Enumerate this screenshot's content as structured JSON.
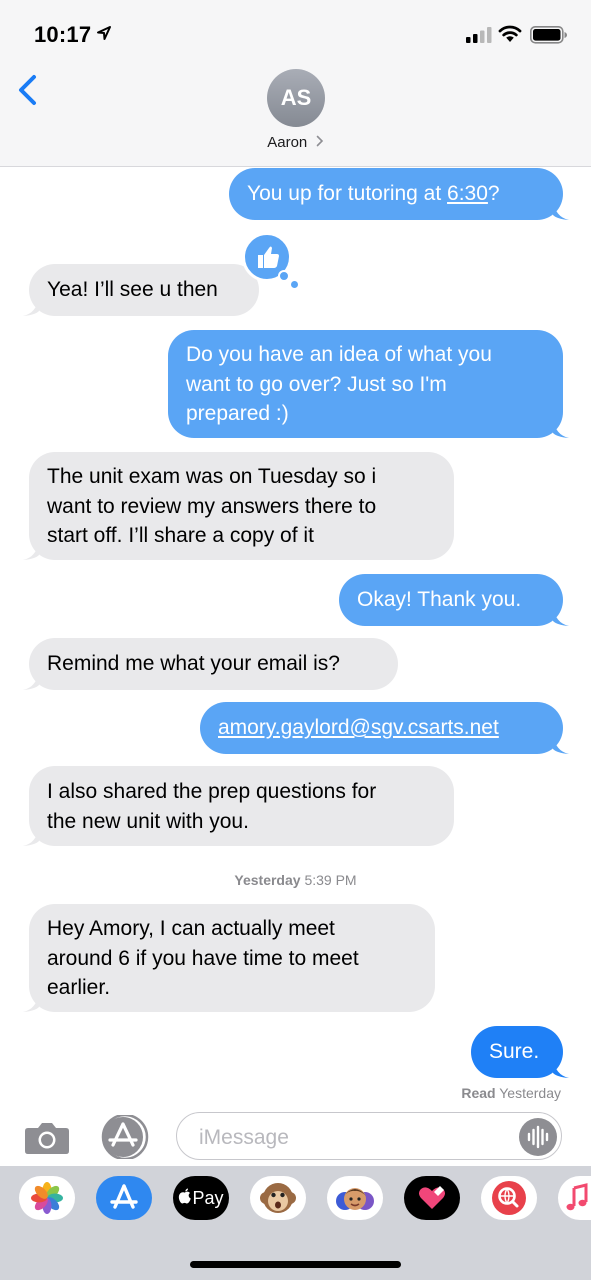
{
  "status_bar": {
    "time": "10:17"
  },
  "header": {
    "avatar_initials": "AS",
    "contact_name": "Aaron"
  },
  "messages": [
    {
      "direction": "outgoing",
      "parts": [
        "You up for tutoring at ",
        "6:30",
        "?"
      ]
    },
    {
      "direction": "incoming",
      "lines": [
        "Yea! I’ll see u then"
      ],
      "tapback": "thumbs-up"
    },
    {
      "direction": "outgoing",
      "lines": [
        "Do you have an idea of what you",
        "want to go over? Just so I'm",
        "prepared :)"
      ]
    },
    {
      "direction": "incoming",
      "lines": [
        "The unit exam was on Tuesday so i",
        "want to review my answers there to",
        "start off. I’ll share a copy of it"
      ]
    },
    {
      "direction": "outgoing",
      "lines": [
        "Okay! Thank you."
      ]
    },
    {
      "direction": "incoming",
      "lines": [
        "Remind me what your email is?"
      ]
    },
    {
      "direction": "outgoing",
      "lines": [
        "amory.gaylord@sgv.csarts.net"
      ],
      "is_link": true
    },
    {
      "direction": "incoming",
      "lines": [
        "I also shared the prep questions for",
        "the new unit with you."
      ]
    },
    {
      "direction": "incoming",
      "lines": [
        "Hey Amory, I can actually meet",
        "around 6 if you have time to meet",
        "earlier."
      ]
    },
    {
      "direction": "outgoing",
      "lines": [
        "Sure."
      ]
    }
  ],
  "timestamp": {
    "day": "Yesterday",
    "time": "5:39 PM"
  },
  "read_receipt": {
    "label": "Read",
    "when": "Yesterday"
  },
  "input": {
    "placeholder": "iMessage"
  },
  "app_drawer": {
    "apps": [
      "photos",
      "app-store",
      "apple-pay",
      "animoji",
      "memoji",
      "digital-touch",
      "web-search",
      "music"
    ],
    "apple_pay_label": "Pay"
  },
  "colors": {
    "outgoing_bubble": "#5aa5f5",
    "outgoing_bubble_latest": "#1f80f6",
    "incoming_bubble": "#e9e9eb",
    "accent": "#1a7cf5"
  }
}
